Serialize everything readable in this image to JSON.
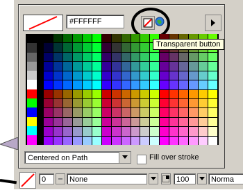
{
  "color_picker": {
    "hex_value": "#FFFFFF",
    "tooltip": "Transparent button"
  },
  "options": {
    "stroke_position": "Centered on Path",
    "fill_over_stroke_label": "Fill over stroke"
  },
  "toolbar": {
    "stroke_width": "0",
    "texture": "None",
    "opacity": "100",
    "mode": "Norma"
  },
  "colors": {
    "highlight": "#000000",
    "tooltip_bg": "#ffffe1",
    "panel_bg": "#d4d0c8",
    "slash_red": "#ff0000"
  }
}
